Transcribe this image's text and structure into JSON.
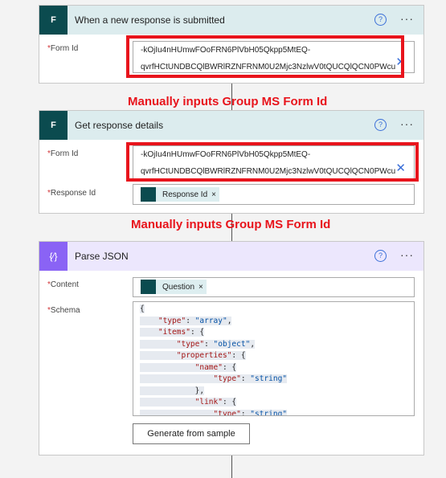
{
  "colors": {
    "forms": "#0b4b4f",
    "forms_header": "#dcecee",
    "parse_json": "#8a63f5",
    "parse_header": "#ece7fd",
    "annotation": "#e8141c"
  },
  "trigger": {
    "title": "When a new response is submitted",
    "form_id_label": "Form Id",
    "form_id_line1": "-kOjIu4nHUmwFOoFRN6PlVbH05Qkpp5MtEQ-",
    "form_id_line2": "qvrfHCtUNDBCQlBWRlRZNFRNM0U2Mjc3NzlwV0tQUCQlQCN0PWcu",
    "icon": "microsoft-forms-icon"
  },
  "annotation1": "Manually inputs Group MS Form Id",
  "get_details": {
    "title": "Get response details",
    "form_id_label": "Form Id",
    "form_id_line1": "-kOjIu4nHUmwFOoFRN6PlVbH05Qkpp5MtEQ-",
    "form_id_line2": "qvrfHCtUNDBCQlBWRlRZNFRNM0U2Mjc3NzlwV0tQUCQlQCN0PWcu",
    "response_id_label": "Response Id",
    "response_id_token": "Response Id"
  },
  "annotation2": "Manually inputs Group MS Form Id",
  "parse": {
    "title": "Parse JSON",
    "content_label": "Content",
    "content_token": "Question",
    "schema_label": "Schema",
    "generate_button": "Generate from sample",
    "schema_lines": [
      "{",
      "    \"type\": \"array\",",
      "    \"items\": {",
      "        \"type\": \"object\",",
      "        \"properties\": {",
      "            \"name\": {",
      "                \"type\": \"string\"",
      "            },",
      "            \"link\": {",
      "                \"type\": \"string\""
    ]
  }
}
